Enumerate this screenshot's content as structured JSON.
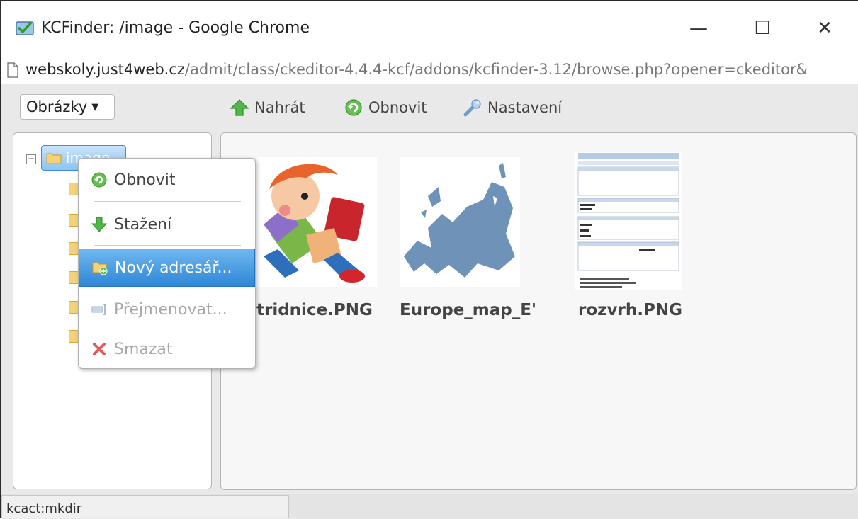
{
  "window": {
    "title": "KCFinder: /image - Google Chrome",
    "minimize_glyph": "—",
    "maximize_glyph": "☐",
    "close_glyph": "✕",
    "app_icon": "kcfinder-check-icon"
  },
  "address": {
    "host": "webskoly.just4web.cz",
    "path": "/admit/class/ckeditor-4.4.4-kcf/addons/kcfinder-3.12/browse.php?opener=ckeditor&"
  },
  "toolbar": {
    "drive_select": "Obrázky",
    "upload_label": "Nahrát",
    "refresh_label": "Obnovit",
    "settings_label": "Nastavení"
  },
  "tree": {
    "root_label": "image",
    "toggle_glyph": "−"
  },
  "files": [
    {
      "name": "tridnice.PNG"
    },
    {
      "name": "Europe_map_E'"
    },
    {
      "name": "rozvrh.PNG"
    }
  ],
  "context_menu": {
    "items": [
      {
        "label": "Obnovit",
        "icon": "refresh-icon",
        "state": "normal"
      },
      {
        "label": "Stažení",
        "icon": "download-arrow-icon",
        "state": "normal"
      },
      {
        "label": "Nový adresář...",
        "icon": "new-folder-icon",
        "state": "active"
      },
      {
        "label": "Přejmenovat...",
        "icon": "rename-icon",
        "state": "disabled"
      },
      {
        "label": "Smazat",
        "icon": "delete-x-icon",
        "state": "disabled"
      }
    ]
  },
  "status": {
    "text": "kcact:mkdir"
  },
  "colors": {
    "selection_blue": "#2f87d6",
    "folder_yellow": "#f4d27a",
    "map_blue": "#6f93b8"
  }
}
